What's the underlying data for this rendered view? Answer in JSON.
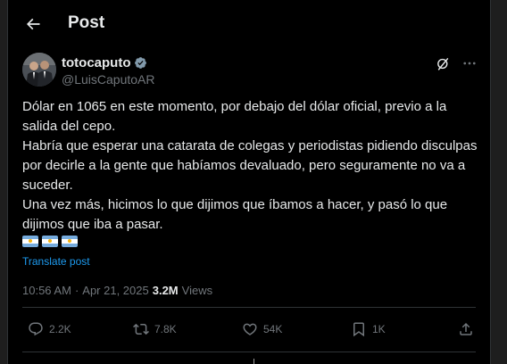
{
  "header": {
    "title": "Post"
  },
  "author": {
    "name": "totocaputo",
    "handle": "@LuisCaputoAR"
  },
  "tweet": {
    "paragraphs": [
      "Dólar en 1065 en este momento, por debajo del dólar oficial, previo a la salida del cepo.",
      "Habría que esperar una catarata de colegas y periodistas pidiendo disculpas por decirle a la gente que habíamos devaluado, pero seguramente no va a suceder.",
      "Una vez más, hicimos lo que dijimos que íbamos a hacer, y pasó lo que dijimos que iba a pasar."
    ],
    "translate_label": "Translate post"
  },
  "meta": {
    "time": "10:56 AM",
    "separator": "·",
    "date": "Apr 21, 2025",
    "views_count": "3.2M",
    "views_label": "Views"
  },
  "actions": {
    "replies": "2.2K",
    "reposts": "7.8K",
    "likes": "54K",
    "bookmarks": "1K"
  },
  "colors": {
    "background": "#000000",
    "text": "#e7e9ea",
    "muted": "#71767b",
    "link": "#1d9bf0",
    "verified": "#829aab"
  }
}
